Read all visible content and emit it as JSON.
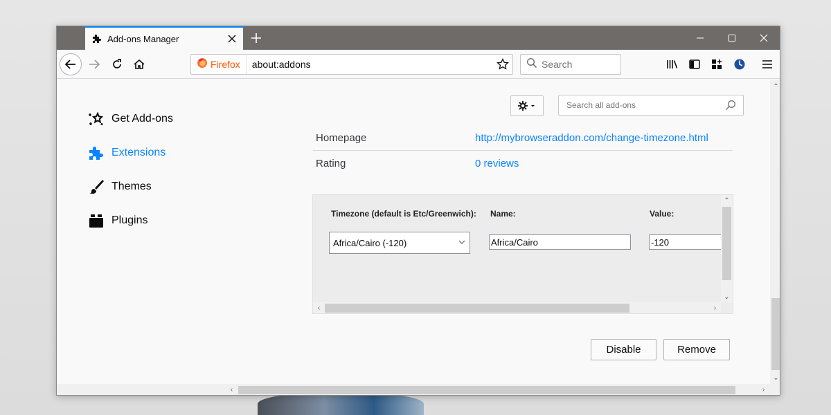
{
  "tab": {
    "title": "Add-ons Manager"
  },
  "urlbar": {
    "identity_label": "Firefox",
    "url": "about:addons"
  },
  "searchbar": {
    "placeholder": "Search"
  },
  "sidebar": {
    "items": [
      {
        "label": "Get Add-ons",
        "icon": "get-addons-icon"
      },
      {
        "label": "Extensions",
        "icon": "puzzle-icon",
        "selected": true
      },
      {
        "label": "Themes",
        "icon": "brush-icon"
      },
      {
        "label": "Plugins",
        "icon": "plugin-icon"
      }
    ]
  },
  "main": {
    "addon_search_placeholder": "Search all add-ons",
    "details": [
      {
        "label": "Homepage",
        "value": "http://mybrowseraddon.com/change-timezone.html"
      },
      {
        "label": "Rating",
        "value": "0 reviews"
      }
    ],
    "prefs": {
      "timezone_label": "Timezone (default is Etc/Greenwich):",
      "timezone_selected": "Africa/Cairo (-120)",
      "name_label": "Name:",
      "name_value": "Africa/Cairo",
      "value_label": "Value:",
      "value_value": "-120"
    },
    "buttons": {
      "disable": "Disable",
      "remove": "Remove"
    }
  },
  "colors": {
    "accent": "#0a84ff",
    "tabbar": "#6f6b69",
    "firefox_label": "#ff5500"
  }
}
